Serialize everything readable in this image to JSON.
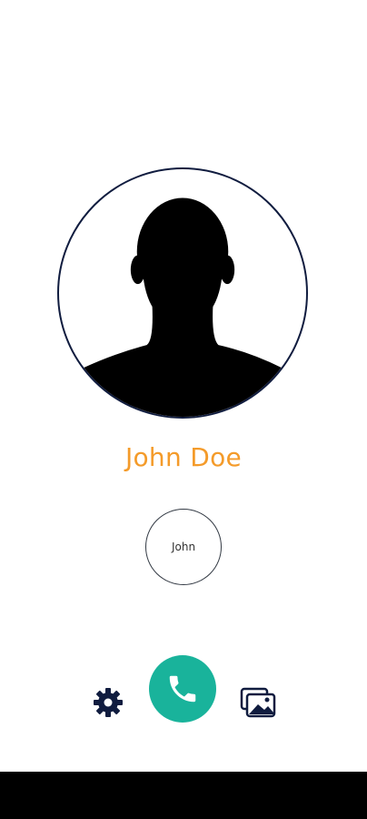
{
  "contact": {
    "full_name": "John Doe",
    "short_name": "John"
  },
  "icons": {
    "settings": "gear-icon",
    "call": "phone-icon",
    "gallery": "gallery-icon"
  },
  "colors": {
    "name_text": "#f49b2a",
    "call_button": "#19b39b",
    "icon_dark": "#101c3f",
    "nav_bar": "#000000"
  }
}
